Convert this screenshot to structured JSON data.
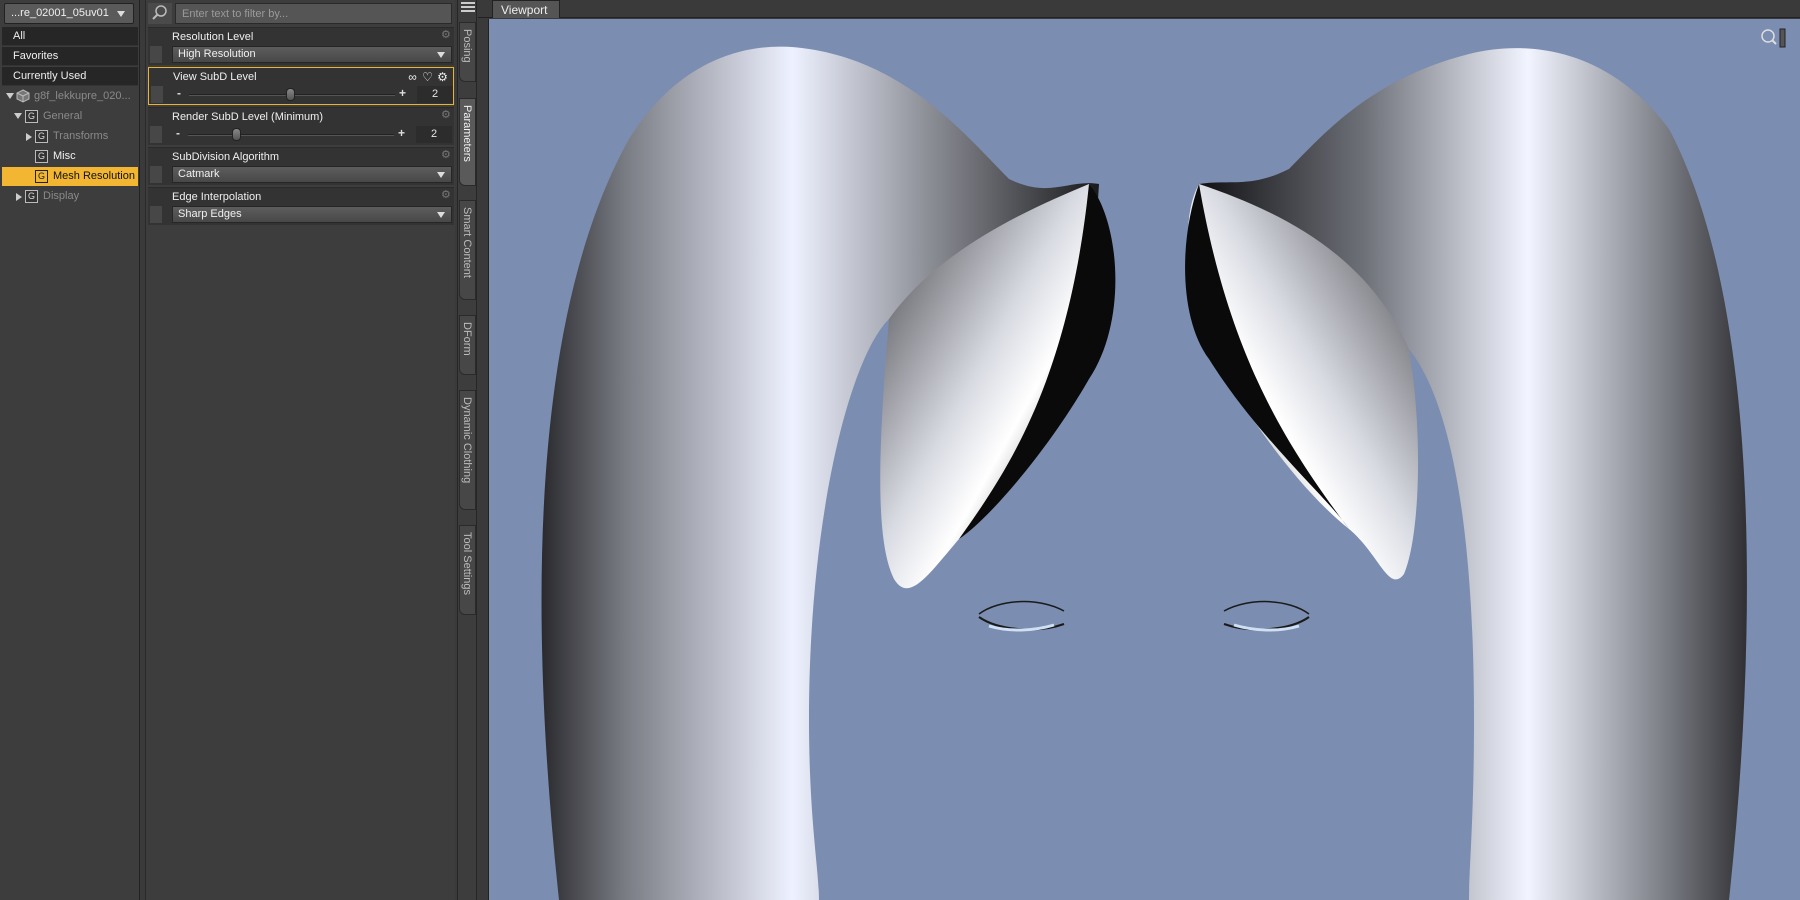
{
  "left_panel": {
    "node_selector": "...re_02001_05uv01",
    "categories": [
      "All",
      "Favorites",
      "Currently Used"
    ],
    "tree": {
      "root": "g8f_lekkupre_020...",
      "general": "General",
      "transforms": "Transforms",
      "misc": "Misc",
      "mesh_resolution": "Mesh Resolution",
      "display": "Display"
    }
  },
  "parameters": {
    "filter_placeholder": "Enter text to filter by...",
    "resolution_level": {
      "label": "Resolution Level",
      "value": "High Resolution"
    },
    "view_subd": {
      "label": "View SubD Level",
      "value": "2",
      "minus": "-",
      "plus": "+"
    },
    "render_subd": {
      "label": "Render SubD Level (Minimum)",
      "value": "2",
      "minus": "-",
      "plus": "+"
    },
    "subdivision_algorithm": {
      "label": "SubDivision Algorithm",
      "value": "Catmark"
    },
    "edge_interpolation": {
      "label": "Edge Interpolation",
      "value": "Sharp Edges"
    }
  },
  "side_tabs": [
    "Posing",
    "Parameters",
    "Smart Content",
    "DForm",
    "Dynamic Clothing",
    "Tool Settings"
  ],
  "viewport": {
    "tab_label": "Viewport",
    "background": "#7b8db0"
  },
  "colors": {
    "selection": "#f2b632",
    "panel": "#3d3d3d"
  }
}
